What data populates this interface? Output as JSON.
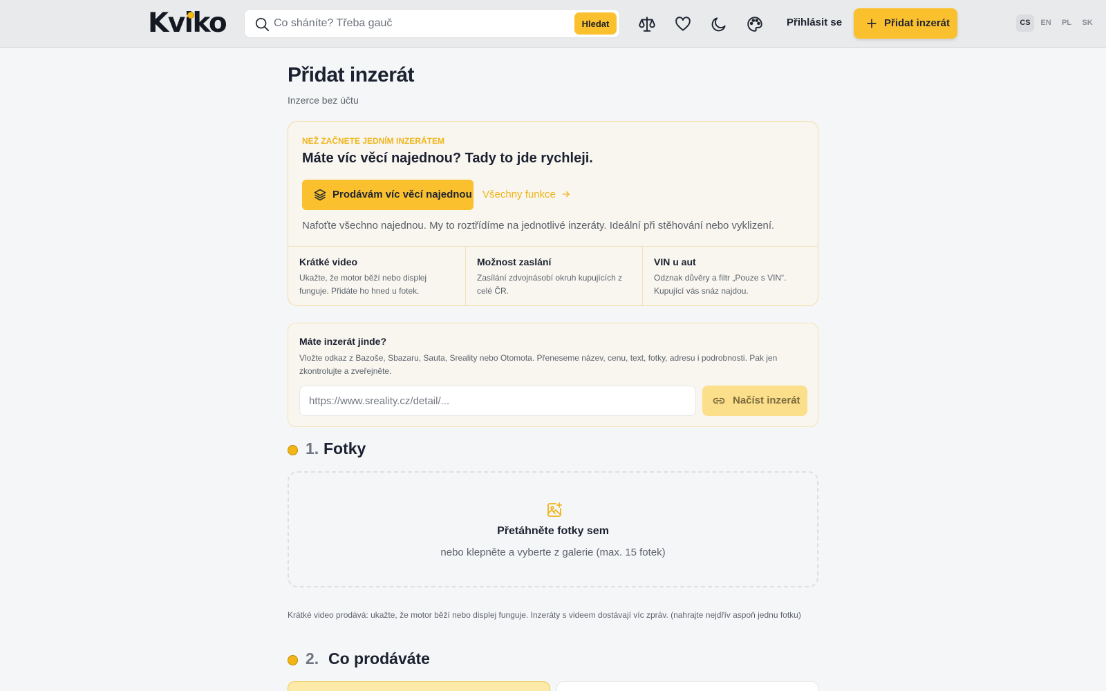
{
  "header": {
    "logo": "Kviko",
    "search_placeholder": "Co sháníte? Třeba gauč",
    "search_button": "Hledat",
    "login": "Přihlásit se",
    "add_listing": "Přidat inzerát",
    "languages": [
      "CS",
      "EN",
      "PL",
      "SK"
    ],
    "active_language": "CS"
  },
  "page": {
    "title": "Přidat inzerát",
    "subtitle": "Inzerce bez účtu"
  },
  "bulk": {
    "eyebrow": "NEŽ ZAČNETE JEDNÍM INZERÁTEM",
    "heading": "Máte víc věcí najednou? Tady to jde rychleji.",
    "button": "Prodávám víc věcí najednou",
    "link": "Všechny funkce",
    "description": "Nafoťte všechno najednou. My to roztřídíme na jednotlivé inzeráty. Ideální při stěhování nebo vyklizení.",
    "features": [
      {
        "title": "Krátké video",
        "text": "Ukažte, že motor běží nebo displej funguje. Přidáte ho hned u fotek."
      },
      {
        "title": "Možnost zaslání",
        "text": "Zasílání zdvojnásobí okruh kupujících z celé ČR."
      },
      {
        "title": "VIN u aut",
        "text": "Odznak důvěry a filtr „Pouze s VIN“. Kupující vás snáz najdou."
      }
    ]
  },
  "import": {
    "title": "Máte inzerát jinde?",
    "description": "Vložte odkaz z Bazoše, Sbazaru, Sauta, Sreality nebo Otomota. Přeneseme název, cenu, text, fotky, adresu i podrobnosti. Pak jen zkontrolujte a zveřejněte.",
    "placeholder": "https://www.sreality.cz/detail/...",
    "button": "Načíst inzerát"
  },
  "sections": [
    {
      "number": "1.",
      "title": "Fotky"
    },
    {
      "number": "2.",
      "title": "Co prodáváte"
    }
  ],
  "photos": {
    "title": "Přetáhněte fotky sem",
    "subtitle": "nebo klepněte a vyberte z galerie (max. 15 fotek)",
    "video_note": "Krátké video prodává: ukažte, že motor běží nebo displej funguje. Inzeráty s videem dostávají víc zpráv. (nahrajte nejdřív aspoň jednu fotku)"
  },
  "colors": {
    "accent": "#fbc02d",
    "accent_text": "#f0b41a"
  },
  "icons": [
    "search-icon",
    "scales-icon",
    "heart-icon",
    "moon-icon",
    "palette-icon",
    "plus-icon",
    "layers-icon",
    "arrow-right-icon",
    "link-icon",
    "image-plus-icon",
    "coin-icon"
  ]
}
